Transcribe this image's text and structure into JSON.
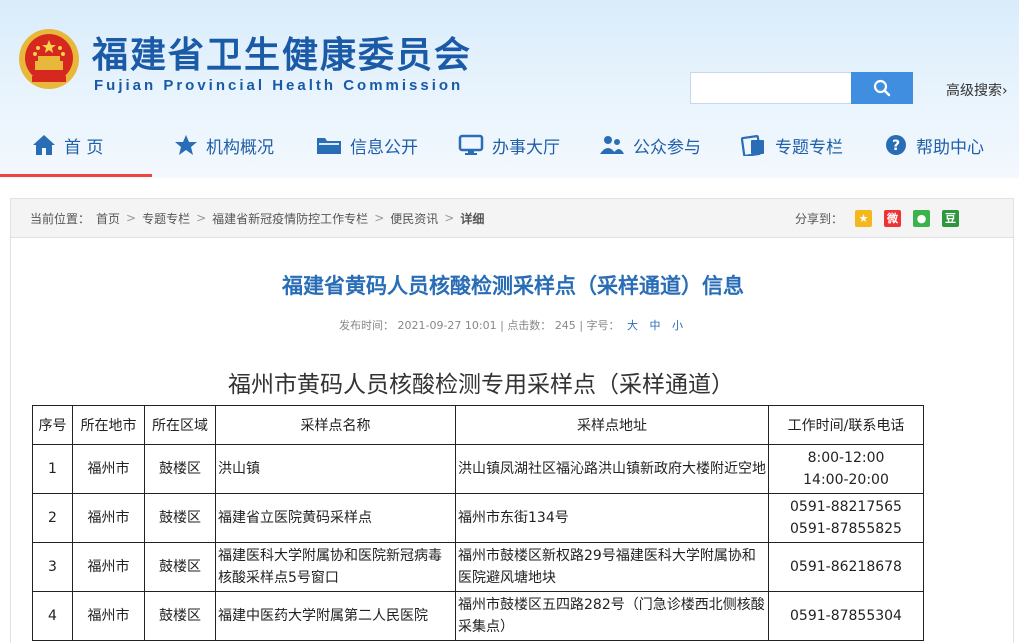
{
  "header": {
    "title": "福建省卫生健康委员会",
    "subtitle": "Fujian Provincial Health Commission",
    "search_placeholder": "",
    "advanced_search": "高级搜索›"
  },
  "nav": {
    "items": [
      {
        "label": "首 页",
        "icon": "home-icon"
      },
      {
        "label": "机构概况",
        "icon": "star-icon"
      },
      {
        "label": "信息公开",
        "icon": "folder-icon"
      },
      {
        "label": "办事大厅",
        "icon": "monitor-icon"
      },
      {
        "label": "公众参与",
        "icon": "people-icon"
      },
      {
        "label": "专题专栏",
        "icon": "topic-icon"
      },
      {
        "label": "帮助中心",
        "icon": "help-icon"
      }
    ],
    "active_index": 0
  },
  "breadcrumb": {
    "prefix": "当前位置：",
    "items": [
      "首页",
      "专题专栏",
      "福建省新冠疫情防控工作专栏",
      "便民资讯",
      "详细"
    ],
    "separator": ">"
  },
  "share": {
    "label": "分享到：",
    "targets": [
      "qzone-icon",
      "weibo-icon",
      "wechat-icon",
      "douban-icon"
    ]
  },
  "article": {
    "title": "福建省黄码人员核酸检测采样点（采样通道）信息",
    "publish_label": "发布时间：",
    "publish_time": "2021-09-27 10:01",
    "clicks_label": "点击数：",
    "clicks": "245",
    "font_label": "字号：",
    "font_sizes": [
      "大",
      "中",
      "小"
    ]
  },
  "table": {
    "heading": "福州市黄码人员核酸检测专用采样点（采样通道）",
    "columns": [
      "序号",
      "所在地市",
      "所在区域",
      "采样点名称",
      "采样点地址",
      "工作时间/联系电话"
    ],
    "rows": [
      {
        "no": "1",
        "city": "福州市",
        "district": "鼓楼区",
        "name": "洪山镇",
        "address": "洪山镇凤湖社区福沁路洪山镇新政府大楼附近空地",
        "contact": [
          "8:00-12:00",
          "14:00-20:00"
        ]
      },
      {
        "no": "2",
        "city": "福州市",
        "district": "鼓楼区",
        "name": "福建省立医院黄码采样点",
        "address": "福州市东街134号",
        "contact": [
          "0591-88217565",
          "0591-87855825"
        ]
      },
      {
        "no": "3",
        "city": "福州市",
        "district": "鼓楼区",
        "name": "福建医科大学附属协和医院新冠病毒核酸采样点5号窗口",
        "address": "福州市鼓楼区新权路29号福建医科大学附属协和医院避风塘地块",
        "contact": [
          "0591-86218678"
        ]
      },
      {
        "no": "4",
        "city": "福州市",
        "district": "鼓楼区",
        "name": "福建中医药大学附属第二人民医院",
        "address": "福州市鼓楼区五四路282号（门急诊楼西北侧核酸采集点）",
        "contact": [
          "0591-87855304"
        ]
      }
    ]
  },
  "colors": {
    "brand": "#1a5aa6",
    "title_blue": "#2a6db7",
    "search_button": "#3f8ee0",
    "nav_active": "#e44444"
  }
}
